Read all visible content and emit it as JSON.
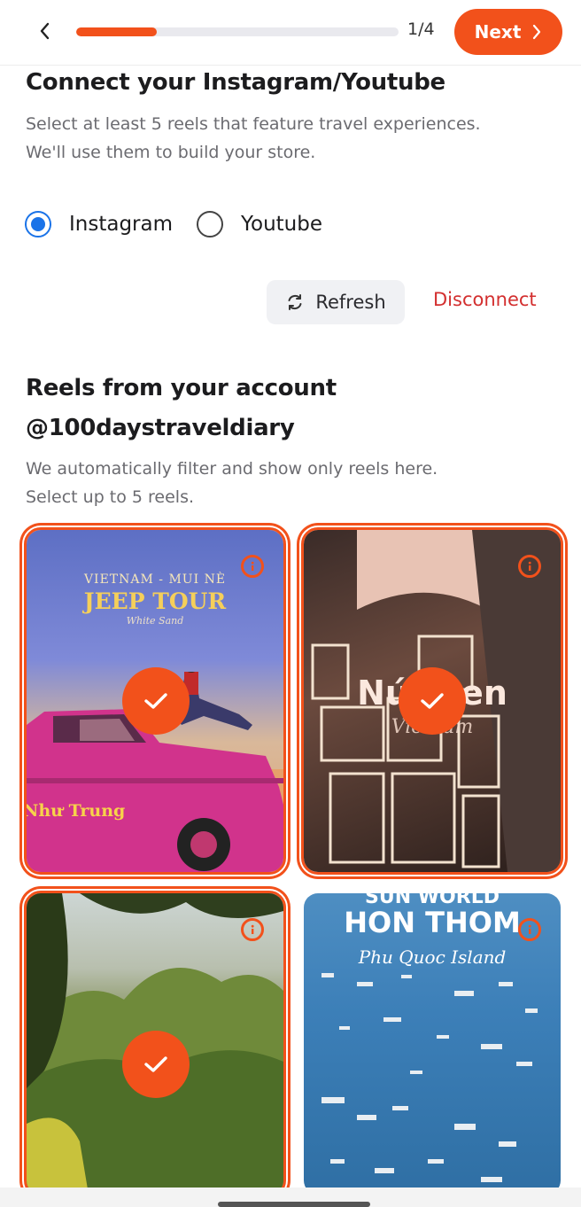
{
  "header": {
    "step_label": "1/4",
    "progress": 0.25,
    "next_label": "Next",
    "accent": "#f2511b"
  },
  "connect": {
    "title": "Connect your Instagram/Youtube",
    "desc_line1": "Select at least 5 reels that feature travel experiences.",
    "desc_line2": "We'll use them to build your store.",
    "options": [
      {
        "label": "Instagram",
        "selected": true
      },
      {
        "label": "Youtube",
        "selected": false
      }
    ],
    "refresh_label": "Refresh",
    "disconnect_label": "Disconnect"
  },
  "reels_section": {
    "title_line1": "Reels from your account",
    "title_line2": "@100daystraveldiary",
    "desc_line1": "We automatically filter and show only reels here.",
    "desc_line2": "Select up to 5 reels."
  },
  "reels": [
    {
      "selected": true,
      "caption_small": "VIETNAM - MUI NÈ",
      "caption_big": "JEEP TOUR",
      "caption_script": "White Sand",
      "car_text": "Như Trung"
    },
    {
      "selected": true,
      "caption_big": "Núi   Đen",
      "caption_script": "Vietnam"
    },
    {
      "selected": true
    },
    {
      "selected": false,
      "caption_top": "SUN WORLD",
      "caption_big": "HON THOM",
      "caption_script": "Phu Quoc Island"
    }
  ]
}
